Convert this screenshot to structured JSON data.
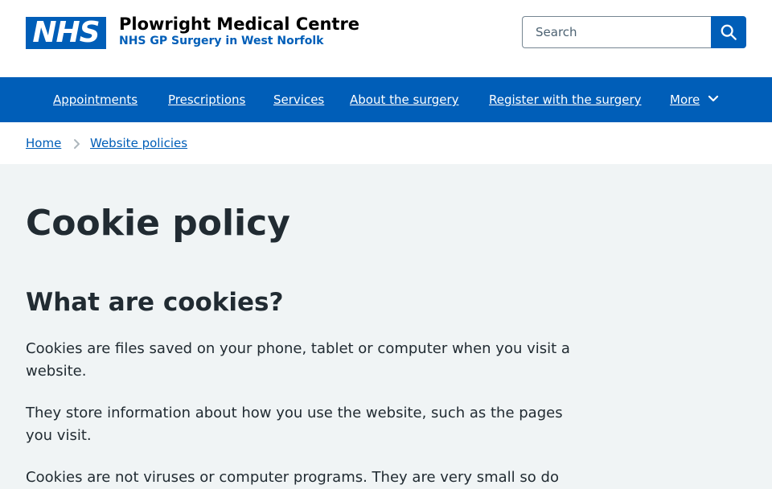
{
  "header": {
    "logo_text": "NHS",
    "org_name": "Plowright Medical Centre",
    "org_subtitle": "NHS GP Surgery in West Norfolk",
    "search": {
      "placeholder": "Search",
      "button_icon": "search-icon"
    }
  },
  "nav": {
    "items": [
      {
        "label": "Appointments"
      },
      {
        "label": "Prescriptions"
      },
      {
        "label": "Services"
      },
      {
        "label": "About the surgery"
      },
      {
        "label": "Register with the surgery"
      },
      {
        "label": "More",
        "icon": "chevron-down-icon"
      }
    ]
  },
  "breadcrumb": {
    "items": [
      {
        "label": "Home"
      },
      {
        "label": "Website policies"
      }
    ],
    "separator_icon": "chevron-right-icon"
  },
  "content": {
    "title": "Cookie policy",
    "section_heading": "What are cookies?",
    "paragraphs": [
      "Cookies are files saved on your phone, tablet or computer when you visit a website.",
      "They store information about how you use the website, such as the pages you visit.",
      "Cookies are not viruses or computer programs. They are very small so do"
    ]
  },
  "colors": {
    "brand_blue": "#005eb8",
    "page_background": "#f0f4f5",
    "text": "#212b32"
  }
}
